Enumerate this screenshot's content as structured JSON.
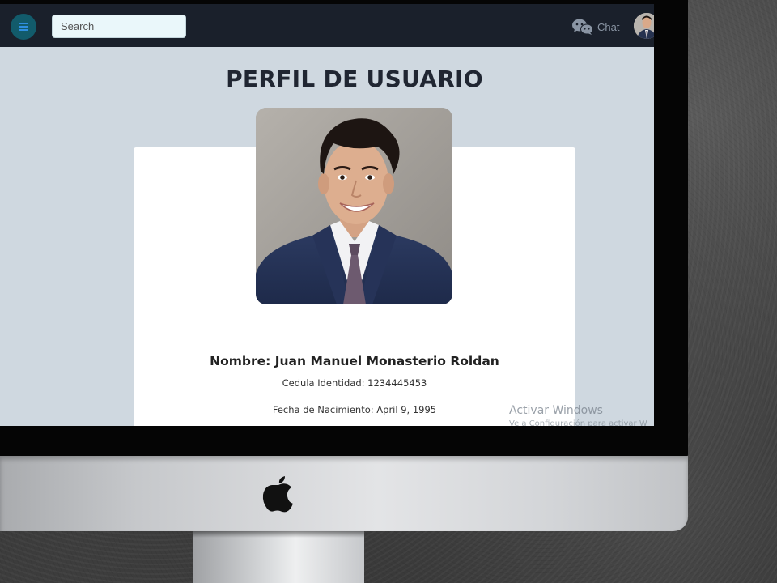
{
  "navbar": {
    "search_placeholder": "Search",
    "chat_label": "Chat",
    "menu_icon": "hamburger-menu-icon",
    "chat_icon": "wechat-icon"
  },
  "main": {
    "title": "PERFIL DE USUARIO",
    "profile": {
      "name_line": "Nombre: Juan Manuel Monasterio Roldan",
      "cedula_line": "Cedula Identidad: 1234445453",
      "birth_line": "Fecha de Nacimiento: April 9, 1995"
    }
  },
  "watermark": {
    "title": "Activar Windows",
    "subtitle": "Ve a Configuración para activar W"
  },
  "colors": {
    "navbar_bg": "#1a202b",
    "page_bg": "#cfd8e0",
    "menu_button_bg": "#125b6b",
    "card_bg": "#ffffff"
  }
}
